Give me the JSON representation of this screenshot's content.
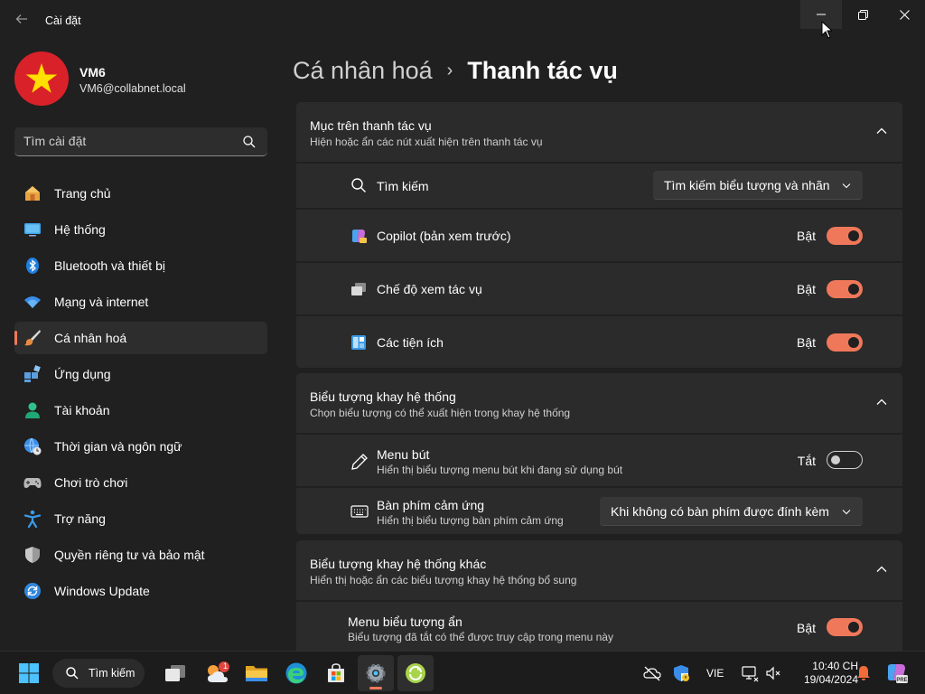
{
  "app": {
    "title": "Cài đặt"
  },
  "profile": {
    "name": "VM6",
    "email": "VM6@collabnet.local"
  },
  "search": {
    "placeholder": "Tìm cài đặt"
  },
  "sidebar": {
    "items": [
      {
        "label": "Trang chủ",
        "icon": "home-icon"
      },
      {
        "label": "Hệ thống",
        "icon": "monitor-icon"
      },
      {
        "label": "Bluetooth và thiết bị",
        "icon": "bluetooth-icon"
      },
      {
        "label": "Mạng và internet",
        "icon": "wifi-icon"
      },
      {
        "label": "Cá nhân hoá",
        "icon": "paintbrush-icon",
        "active": true
      },
      {
        "label": "Ứng dụng",
        "icon": "apps-icon"
      },
      {
        "label": "Tài khoản",
        "icon": "person-icon"
      },
      {
        "label": "Thời gian và ngôn ngữ",
        "icon": "globe-clock-icon"
      },
      {
        "label": "Chơi trò chơi",
        "icon": "gamepad-icon"
      },
      {
        "label": "Trợ năng",
        "icon": "accessibility-icon"
      },
      {
        "label": "Quyền riêng tư và bảo mật",
        "icon": "shield-icon"
      },
      {
        "label": "Windows Update",
        "icon": "update-icon"
      }
    ]
  },
  "breadcrumb": {
    "parent": "Cá nhân hoá",
    "separator": "›",
    "current": "Thanh tác vụ"
  },
  "sections": {
    "taskbar_items": {
      "title": "Mục trên thanh tác vụ",
      "subtitle": "Hiện hoặc ẩn các nút xuất hiện trên thanh tác vụ",
      "search": {
        "label": "Tìm kiếm",
        "value": "Tìm kiếm biểu tượng và nhãn"
      },
      "copilot": {
        "label": "Copilot (bản xem trước)",
        "state": "Bật"
      },
      "task_view": {
        "label": "Chế độ xem tác vụ",
        "state": "Bật"
      },
      "widgets": {
        "label": "Các tiện ích",
        "state": "Bật"
      }
    },
    "system_tray": {
      "title": "Biểu tượng khay hệ thống",
      "subtitle": "Chọn biểu tượng có thể xuất hiện trong khay hệ thống",
      "pen_menu": {
        "label": "Menu bút",
        "sub": "Hiển thị biểu tượng menu bút khi đang sử dụng bút",
        "state": "Tắt"
      },
      "touch_keyboard": {
        "label": "Bàn phím cảm ứng",
        "sub": "Hiển thị biểu tượng bàn phím cảm ứng",
        "value": "Khi không có bàn phím được đính kèm"
      }
    },
    "other_tray": {
      "title": "Biểu tượng khay hệ thống khác",
      "subtitle": "Hiển thị hoặc ẩn các biểu tượng khay hệ thống bổ sung",
      "hidden_menu": {
        "label": "Menu biểu tượng ẩn",
        "sub": "Biểu tượng đã tắt có thể được truy cập trong menu này",
        "state": "Bật"
      }
    }
  },
  "taskbar": {
    "search_label": "Tìm kiếm",
    "weather_badge": "1",
    "language": "VIE",
    "time": "10:40 CH",
    "date": "19/04/2024"
  },
  "colors": {
    "accent": "#f0785a",
    "background": "#202020",
    "card": "#2b2b2b"
  }
}
